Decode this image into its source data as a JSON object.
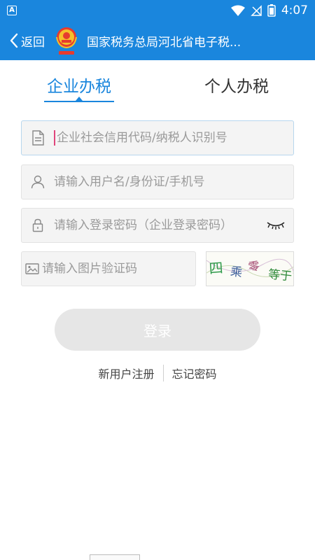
{
  "status_bar": {
    "indicator": "A",
    "time": "4:07"
  },
  "nav": {
    "back_label": "返回",
    "title": "国家税务总局河北省电子税..."
  },
  "tabs": [
    {
      "label": "企业办税",
      "active": true
    },
    {
      "label": "个人办税",
      "active": false
    }
  ],
  "form": {
    "tax_id_placeholder": "企业社会信用代码/纳税人识别号",
    "username_placeholder": "请输入用户名/身份证/手机号",
    "password_placeholder": "请输入登录密码（企业登录密码）",
    "captcha_placeholder": "请输入图片验证码",
    "captcha_image_text": "四乘零等于?"
  },
  "login_button": "登录",
  "links": {
    "register": "新用户注册",
    "forgot_password": "忘记密码"
  },
  "colors": {
    "brand": "#1a86dd",
    "login_disabled": "#e6e6e6",
    "cursor": "#e0457b"
  }
}
